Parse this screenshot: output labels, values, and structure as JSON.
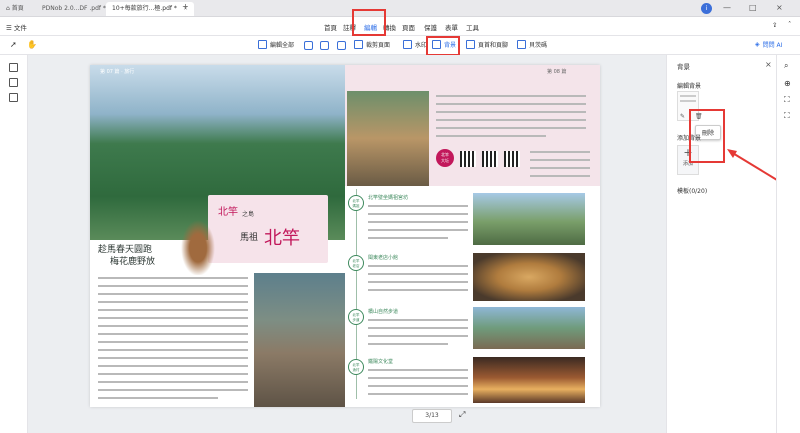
{
  "tabs": [
    {
      "label": "首頁",
      "close": ""
    },
    {
      "label": "PDNob 2.0...DF .pdf *",
      "close": "×"
    },
    {
      "label": "10+每款旅行...極.pdf *",
      "close": "×"
    }
  ],
  "tab_add": "+",
  "window": {
    "minimize": "—",
    "maximize": "□",
    "close": "×"
  },
  "file_menu": "文件",
  "menu": {
    "items": [
      "首頁",
      "註釋",
      "編輯",
      "轉換",
      "頁面",
      "保護",
      "表單",
      "工具"
    ],
    "active": "編輯"
  },
  "toolbar": {
    "items": [
      "編輯全部",
      "裁剪頁面",
      "水印",
      "背景",
      "頁首和頁腳",
      "貝茨碼"
    ],
    "active": "背景",
    "ask_ai": "問問 AI"
  },
  "pager": {
    "current": "3/13"
  },
  "page": {
    "header_left": "第 07 篇 · 旅行",
    "header_right": "第 08 篇",
    "section_label": "北竿",
    "section_small": "之島",
    "section_sub": "馬祖",
    "big_title": "北竿",
    "headline_line1": "趁馬春天圓跑",
    "headline_line2": "梅花鹿野放",
    "feature_badge": "北竿\n大坵",
    "items": [
      {
        "tag": "北竿\n媽祖",
        "title": "北竿璧坐媽祖宮坊"
      },
      {
        "tag": "北竿\n老店",
        "title": "閩東老店小館"
      },
      {
        "tag": "北竿\n步道",
        "title": "橋山自然步道"
      },
      {
        "tag": "北竿\n漁村",
        "title": "鐵陽文化堂"
      }
    ]
  },
  "panel": {
    "title": "背景",
    "edit_background": "編輯背景",
    "add_background": "添加背景",
    "add_label": "添加",
    "template_title": "模板(0/20)",
    "delete_tooltip": "刪除"
  },
  "colors": {
    "accent": "#2e6fe8",
    "highlight": "#e53935",
    "pink": "#c2185b",
    "green": "#3f8a5e"
  }
}
